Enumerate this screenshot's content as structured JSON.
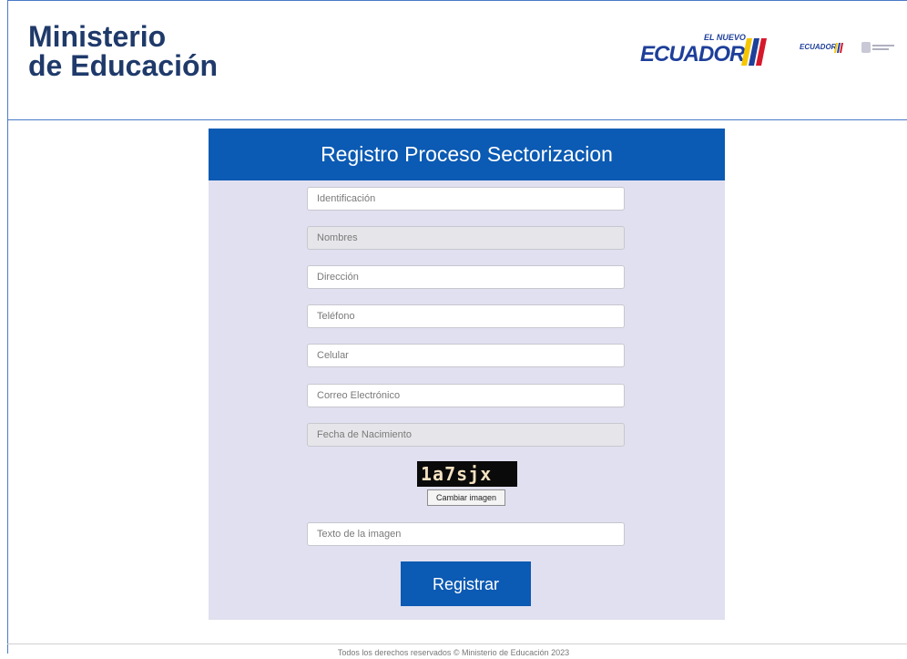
{
  "header": {
    "brand_line1": "Ministerio",
    "brand_line2": "de Educación",
    "ecuador_word": "ECUADOR",
    "ecuador_sub": "EL NUEVO",
    "ecuador_small_word": "ECUADOR"
  },
  "form": {
    "title": "Registro Proceso Sectorizacion",
    "fields": {
      "identificacion": "Identificación",
      "nombres": "Nombres",
      "direccion": "Dirección",
      "telefono": "Teléfono",
      "celular": "Celular",
      "correo": "Correo Electrónico",
      "fecha": "Fecha de Nacimiento",
      "captcha_text": "Texto de la imagen"
    },
    "captcha": {
      "code": "1a7sjx",
      "change_label": "Cambiar imagen"
    },
    "submit_label": "Registrar"
  },
  "footer": {
    "text": "Todos los derechos reservados © Ministerio de Educación 2023"
  },
  "colors": {
    "primary": "#0b5ab3",
    "panel_bg": "#e0e0f0",
    "brand": "#1f3a6a"
  }
}
